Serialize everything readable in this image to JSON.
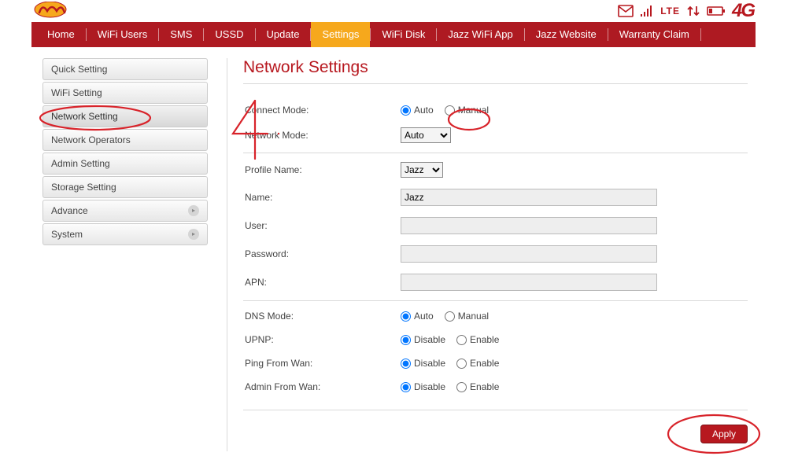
{
  "header": {
    "lte_label": "LTE",
    "fourg_label": "4G"
  },
  "nav": {
    "items": [
      {
        "label": "Home",
        "active": false
      },
      {
        "label": "WiFi Users",
        "active": false
      },
      {
        "label": "SMS",
        "active": false
      },
      {
        "label": "USSD",
        "active": false
      },
      {
        "label": "Update",
        "active": false
      },
      {
        "label": "Settings",
        "active": true
      },
      {
        "label": "WiFi Disk",
        "active": false
      },
      {
        "label": "Jazz WiFi App",
        "active": false
      },
      {
        "label": "Jazz Website",
        "active": false
      },
      {
        "label": "Warranty Claim",
        "active": false
      }
    ]
  },
  "sidebar": {
    "items": [
      {
        "label": "Quick Setting",
        "active": false,
        "arrow": false
      },
      {
        "label": "WiFi Setting",
        "active": false,
        "arrow": false
      },
      {
        "label": "Network Setting",
        "active": true,
        "arrow": false
      },
      {
        "label": "Network Operators",
        "active": false,
        "arrow": false
      },
      {
        "label": "Admin Setting",
        "active": false,
        "arrow": false
      },
      {
        "label": "Storage Setting",
        "active": false,
        "arrow": false
      },
      {
        "label": "Advance",
        "active": false,
        "arrow": true
      },
      {
        "label": "System",
        "active": false,
        "arrow": true
      }
    ]
  },
  "main": {
    "title": "Network Settings",
    "connect_mode_label": "Connect Mode:",
    "connect_mode_opts": {
      "auto": "Auto",
      "manual": "Manual"
    },
    "connect_mode_value": "auto",
    "network_mode_label": "Network Mode:",
    "network_mode_value": "Auto",
    "profile_name_label": "Profile Name:",
    "profile_name_value": "Jazz",
    "name_label": "Name:",
    "name_value": "Jazz",
    "user_label": "User:",
    "user_value": "",
    "password_label": "Password:",
    "password_value": "",
    "apn_label": "APN:",
    "apn_value": "",
    "dns_mode_label": "DNS Mode:",
    "dns_mode_opts": {
      "auto": "Auto",
      "manual": "Manual"
    },
    "dns_mode_value": "auto",
    "upnp_label": "UPNP:",
    "upnp_opts": {
      "disable": "Disable",
      "enable": "Enable"
    },
    "upnp_value": "disable",
    "ping_wan_label": "Ping From Wan:",
    "ping_wan_opts": {
      "disable": "Disable",
      "enable": "Enable"
    },
    "ping_wan_value": "disable",
    "admin_wan_label": "Admin From Wan:",
    "admin_wan_opts": {
      "disable": "Disable",
      "enable": "Enable"
    },
    "admin_wan_value": "disable",
    "apply_label": "Apply"
  }
}
